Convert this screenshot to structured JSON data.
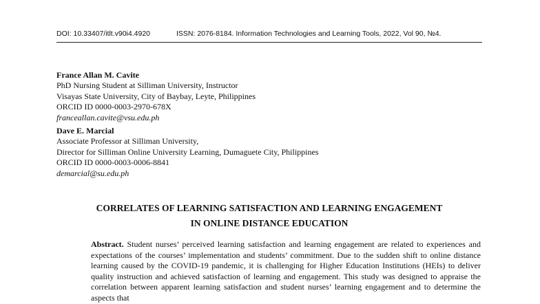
{
  "header": {
    "doi": "DOI: 10.33407/itlt.v90i4.4920",
    "issn": "ISSN: 2076-8184. Information Technologies and Learning Tools, 2022, Vol 90, №4."
  },
  "authors": [
    {
      "name": "France Allan M. Cavite",
      "lines": [
        "PhD Nursing Student at Silliman University, Instructor",
        "Visayas State University, City of Baybay, Leyte, Philippines",
        "ORCID ID 0000-0003-2970-678X"
      ],
      "email": "franceallan.cavite@vsu.edu.ph"
    },
    {
      "name": "Dave E. Marcial",
      "lines": [
        "Associate Professor at Silliman University,",
        "Director for Silliman Online University Learning, Dumaguete City, Philippines",
        "ORCID ID 0000-0003-0006-8841"
      ],
      "email": "demarcial@su.edu.ph"
    }
  ],
  "title": {
    "line1": "CORRELATES OF LEARNING SATISFACTION AND LEARNING ENGAGEMENT",
    "line2": "IN ONLINE DISTANCE EDUCATION"
  },
  "abstract": {
    "label": "Abstract.",
    "text": "Student nurses’ perceived learning satisfaction and learning engagement are related to experiences and expectations of the courses’ implementation and students’ commitment. Due to the sudden shift to online distance learning caused by the COVID-19 pandemic, it is challenging for Higher Education Institutions (HEIs) to deliver quality instruction and achieved satisfaction of learning and engagement. This study was designed to appraise the correlation between apparent learning satisfaction and student nurses’ learning engagement and to determine the aspects that"
  }
}
